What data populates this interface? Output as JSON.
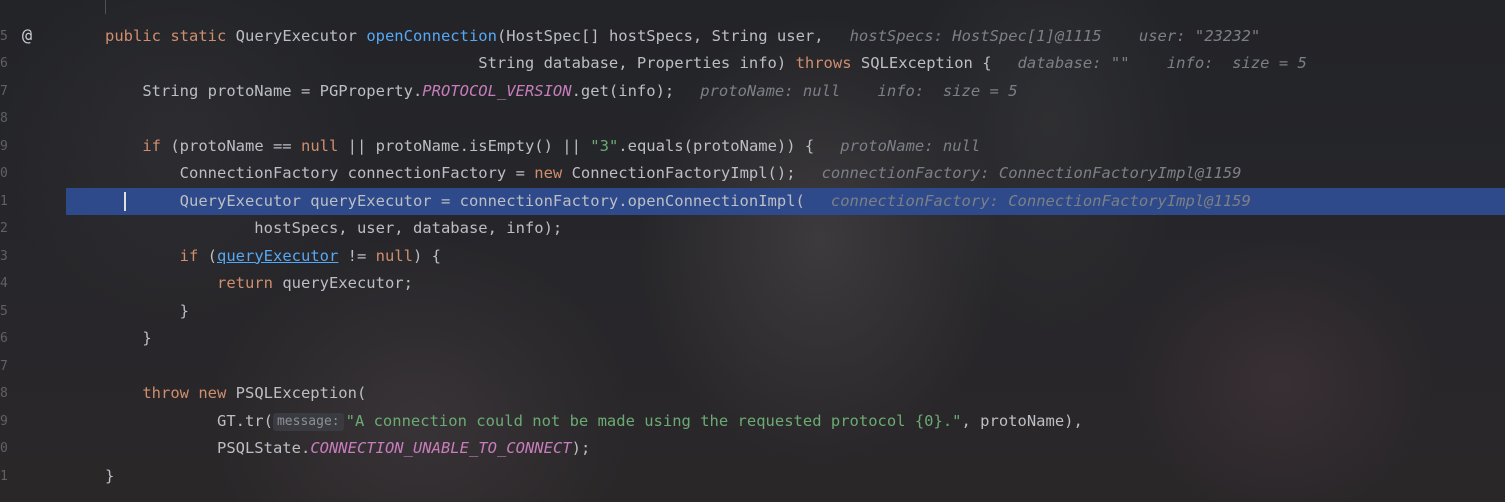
{
  "gutter": {
    "line_numbers": [
      "5",
      "6",
      "7",
      "8",
      "9",
      "0",
      "1",
      "2",
      "3",
      "4",
      "5",
      "6",
      "7",
      "8",
      "9",
      "0",
      "1"
    ],
    "marker": "@"
  },
  "editor": {
    "lines": [
      {
        "tokens": [
          {
            "t": "public static ",
            "c": "kw"
          },
          {
            "t": "QueryExecutor ",
            "c": "ty"
          },
          {
            "t": "openConnection",
            "c": "fn"
          },
          {
            "t": "(HostSpec[] hostSpecs, String user,",
            "c": "tx"
          }
        ],
        "hint": "hostSpecs: HostSpec[1]@1115    user: \"23232\""
      },
      {
        "tokens": [
          {
            "t": "                                        String database, Properties info) ",
            "c": "tx"
          },
          {
            "t": "throws ",
            "c": "kw"
          },
          {
            "t": "SQLException {",
            "c": "tx"
          }
        ],
        "hint": "database: \"\"    info:  size = 5"
      },
      {
        "tokens": [
          {
            "t": "    String protoName = PGProperty.",
            "c": "tx"
          },
          {
            "t": "PROTOCOL_VERSION",
            "c": "sf"
          },
          {
            "t": ".get(info);",
            "c": "tx"
          }
        ],
        "hint": "protoName: null    info:  size = 5"
      },
      {
        "tokens": [
          {
            "t": "",
            "c": "tx"
          }
        ],
        "hint": ""
      },
      {
        "tokens": [
          {
            "t": "    ",
            "c": "tx"
          },
          {
            "t": "if ",
            "c": "kw"
          },
          {
            "t": "(protoName == ",
            "c": "tx"
          },
          {
            "t": "null ",
            "c": "kw"
          },
          {
            "t": "|| protoName.isEmpty() || ",
            "c": "tx"
          },
          {
            "t": "\"3\"",
            "c": "st"
          },
          {
            "t": ".equals(protoName)) {",
            "c": "tx"
          }
        ],
        "hint": "protoName: null"
      },
      {
        "tokens": [
          {
            "t": "        ConnectionFactory connectionFactory = ",
            "c": "tx"
          },
          {
            "t": "new ",
            "c": "kw"
          },
          {
            "t": "ConnectionFactoryImpl();",
            "c": "tx"
          }
        ],
        "hint": "connectionFactory: ConnectionFactoryImpl@1159"
      },
      {
        "tokens": [
          {
            "t": "        QueryExecutor queryExecutor = connectionFactory.openConnectionImpl(",
            "c": "tx"
          }
        ],
        "hint": "connectionFactory: ConnectionFactoryImpl@1159"
      },
      {
        "tokens": [
          {
            "t": "                hostSpecs, user, database, info);",
            "c": "tx"
          }
        ],
        "hint": ""
      },
      {
        "tokens": [
          {
            "t": "        ",
            "c": "tx"
          },
          {
            "t": "if ",
            "c": "kw"
          },
          {
            "t": "(",
            "c": "tx"
          },
          {
            "t": "queryExecutor",
            "c": "ul"
          },
          {
            "t": " != ",
            "c": "tx"
          },
          {
            "t": "null",
            "c": "kw"
          },
          {
            "t": ") {",
            "c": "tx"
          }
        ],
        "hint": ""
      },
      {
        "tokens": [
          {
            "t": "            ",
            "c": "tx"
          },
          {
            "t": "return ",
            "c": "kw"
          },
          {
            "t": "queryExecutor;",
            "c": "tx"
          }
        ],
        "hint": ""
      },
      {
        "tokens": [
          {
            "t": "        }",
            "c": "tx"
          }
        ],
        "hint": ""
      },
      {
        "tokens": [
          {
            "t": "    }",
            "c": "tx"
          }
        ],
        "hint": ""
      },
      {
        "tokens": [
          {
            "t": "",
            "c": "tx"
          }
        ],
        "hint": ""
      },
      {
        "tokens": [
          {
            "t": "    ",
            "c": "tx"
          },
          {
            "t": "throw new ",
            "c": "kw"
          },
          {
            "t": "PSQLException(",
            "c": "tx"
          }
        ],
        "hint": ""
      },
      {
        "tokens": [
          {
            "t": "            GT.tr(",
            "c": "tx"
          },
          {
            "t": "message:",
            "c": "param"
          },
          {
            "t": "\"A connection could not be made using the requested protocol {0}.\"",
            "c": "st"
          },
          {
            "t": ", protoName),",
            "c": "tx"
          }
        ],
        "hint": ""
      },
      {
        "tokens": [
          {
            "t": "            PSQLState.",
            "c": "tx"
          },
          {
            "t": "CONNECTION_UNABLE_TO_CONNECT",
            "c": "sf"
          },
          {
            "t": ");",
            "c": "tx"
          }
        ],
        "hint": ""
      },
      {
        "tokens": [
          {
            "t": "}",
            "c": "tx"
          }
        ],
        "hint": ""
      }
    ],
    "current_line_index": 6
  },
  "colors": {
    "background": "#1e1f22",
    "keyword": "#cf8e6d",
    "method": "#56a8f5",
    "string": "#6aab73",
    "static_field": "#c77dbb",
    "text": "#bcbec4",
    "inline_hint": "#7c7f86",
    "execution_line": "#2e4a8a"
  }
}
